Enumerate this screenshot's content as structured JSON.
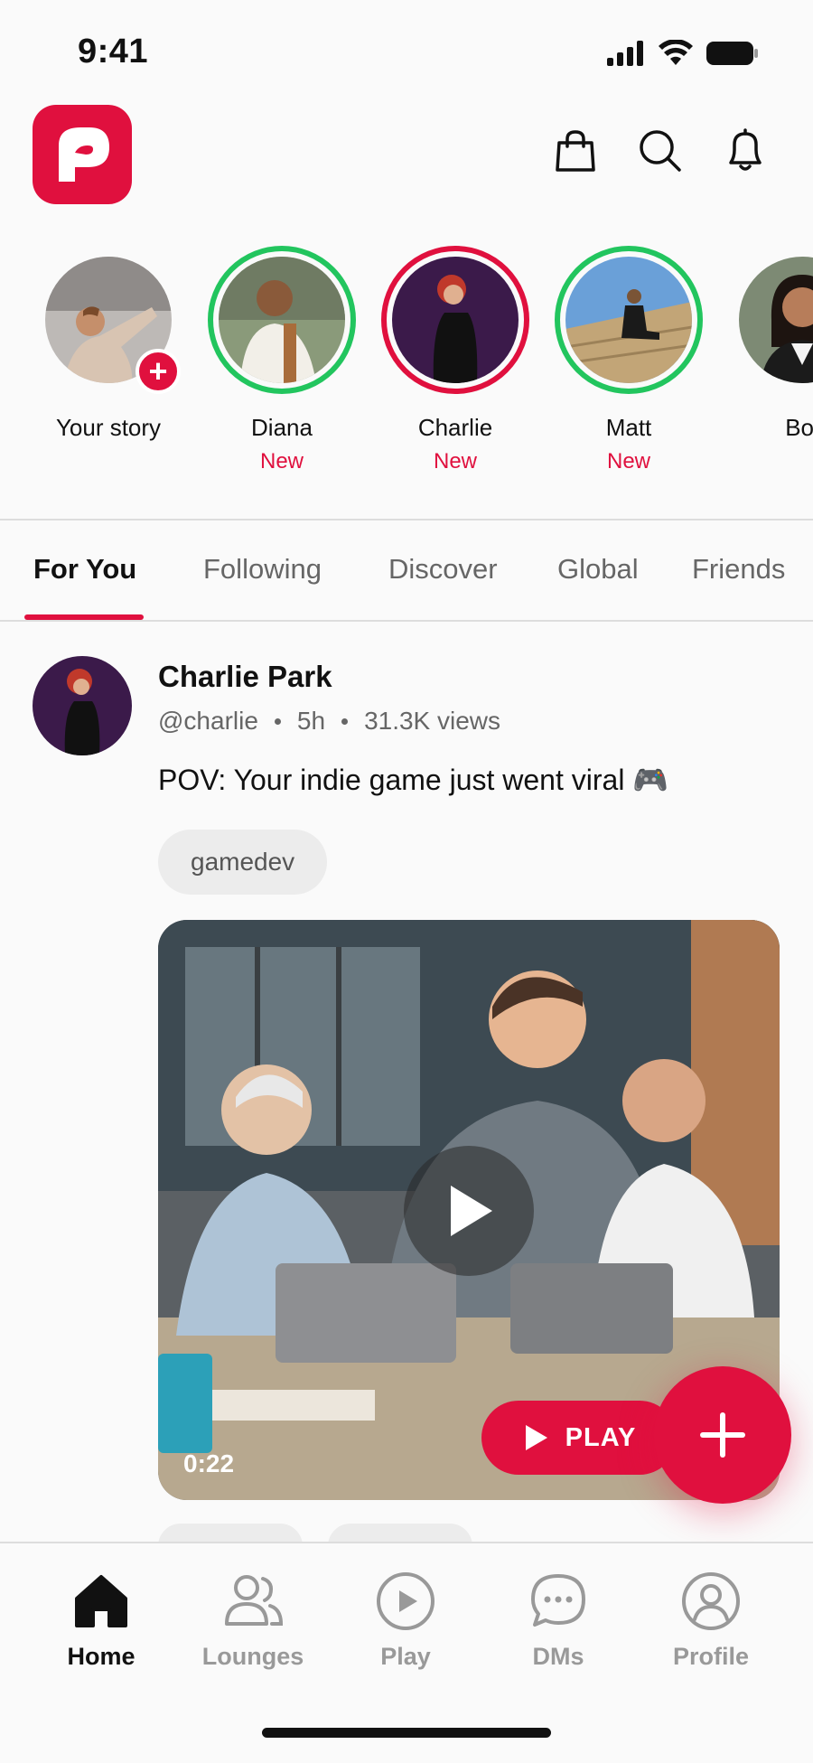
{
  "status_bar": {
    "time": "9:41",
    "icons": [
      "signal-icon",
      "wifi-icon",
      "battery-icon"
    ]
  },
  "header": {
    "logo_letter": "P",
    "icons": [
      "shopping-bag-icon",
      "search-icon",
      "bell-icon"
    ]
  },
  "stories": [
    {
      "name": "Your story",
      "badge": "+",
      "is_new": false
    },
    {
      "name": "Diana",
      "new_label": "New",
      "ring": "green"
    },
    {
      "name": "Charlie",
      "new_label": "New",
      "ring": "red"
    },
    {
      "name": "Matt",
      "new_label": "New",
      "ring": "green"
    },
    {
      "name": "Bol"
    }
  ],
  "tabs": [
    {
      "label": "For You",
      "active": true
    },
    {
      "label": "Following"
    },
    {
      "label": "Discover"
    },
    {
      "label": "Global"
    },
    {
      "label": "Friends"
    }
  ],
  "post": {
    "author": "Charlie Park",
    "handle": "@charlie",
    "time": "5h",
    "views": "31.3K views",
    "caption": "POV: Your indie game just went viral 🎮",
    "tag": "gamedev",
    "duration": "0:22",
    "play_label": "PLAY"
  },
  "bottom_nav": [
    {
      "label": "Home",
      "icon": "home-icon",
      "active": true
    },
    {
      "label": "Lounges",
      "icon": "users-icon"
    },
    {
      "label": "Play",
      "icon": "play-circle-icon"
    },
    {
      "label": "DMs",
      "icon": "chat-bubble-icon"
    },
    {
      "label": "Profile",
      "icon": "user-circle-icon"
    }
  ],
  "colors": {
    "accent": "#e0103e",
    "ring_green": "#22c55e",
    "muted": "#999999"
  }
}
